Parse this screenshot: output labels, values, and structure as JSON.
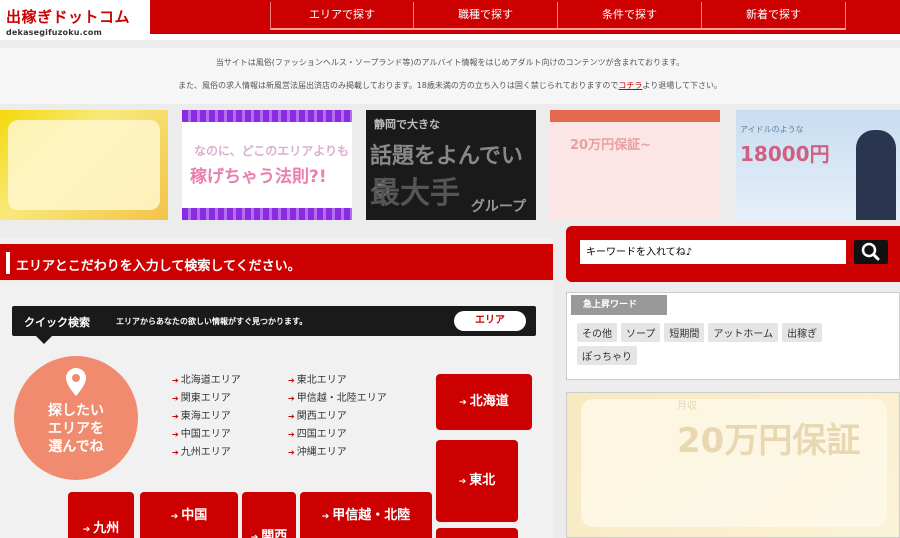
{
  "header": {
    "logo_main": "出稼ぎドットコム",
    "logo_sub": "dekasegifuzoku.com",
    "nav": [
      {
        "label": "エリアで探す"
      },
      {
        "label": "職種で探す"
      },
      {
        "label": "条件で探す"
      },
      {
        "label": "新着で探す"
      }
    ]
  },
  "notice": {
    "line1": "当サイトは風俗(ファッションヘルス・ソープランド等)のアルバイト情報をはじめアダルト向けのコンテンツが含まれております。",
    "line2_pre": "また、風俗の求人情報は新風営法届出済店のみ掲載しております。18歳未満の方の立ち入りは固く禁じられておりますので",
    "line2_link": "コチラ",
    "line2_post": "より退場して下さい。"
  },
  "banners": {
    "b2_line1": "なのに、どこのエリアよりも",
    "b2_line2": "稼げちゃう法則?!",
    "b3_line1": "静岡で大きな",
    "b3_line2": "話題をよんでいる",
    "b3_line3": "最大手",
    "b3_line4": "グループ",
    "b4_line1": "20万円保証~",
    "b5_line1": "アイドルのような",
    "b5_line2": "18000円"
  },
  "search": {
    "title": "エリアとこだわりを入力して検索してください。",
    "quick_title": "クイック検索",
    "quick_desc": "エリアからあなたの欲しい情報がすぐ見つかります。",
    "quick_button": "エリア",
    "circle_line1": "探したい",
    "circle_line2": "エリアを",
    "circle_line3": "選んでね",
    "areas_col1": [
      "北海道エリア",
      "関東エリア",
      "東海エリア",
      "中国エリア",
      "九州エリア"
    ],
    "areas_col2": [
      "東北エリア",
      "甲信越・北陸エリア",
      "関西エリア",
      "四国エリア",
      "沖縄エリア"
    ],
    "map": {
      "hokkaido": "北海道",
      "tohoku": "東北",
      "chugoku": "中国",
      "kyushu": "九州",
      "kansai": "関西",
      "koshinetsu": "甲信越・北陸"
    }
  },
  "keyword": {
    "placeholder": "キーワードを入れてね♪"
  },
  "trend": {
    "title": "急上昇ワード",
    "tags": [
      "その他",
      "ソープ",
      "短期間",
      "アットホーム",
      "出稼ぎ",
      "ぽっちゃり"
    ]
  },
  "right_ad": {
    "line1": "月収",
    "line2": "20万円保証"
  },
  "colors": {
    "brand_red": "#cc0000",
    "circle": "#f08b6f"
  }
}
